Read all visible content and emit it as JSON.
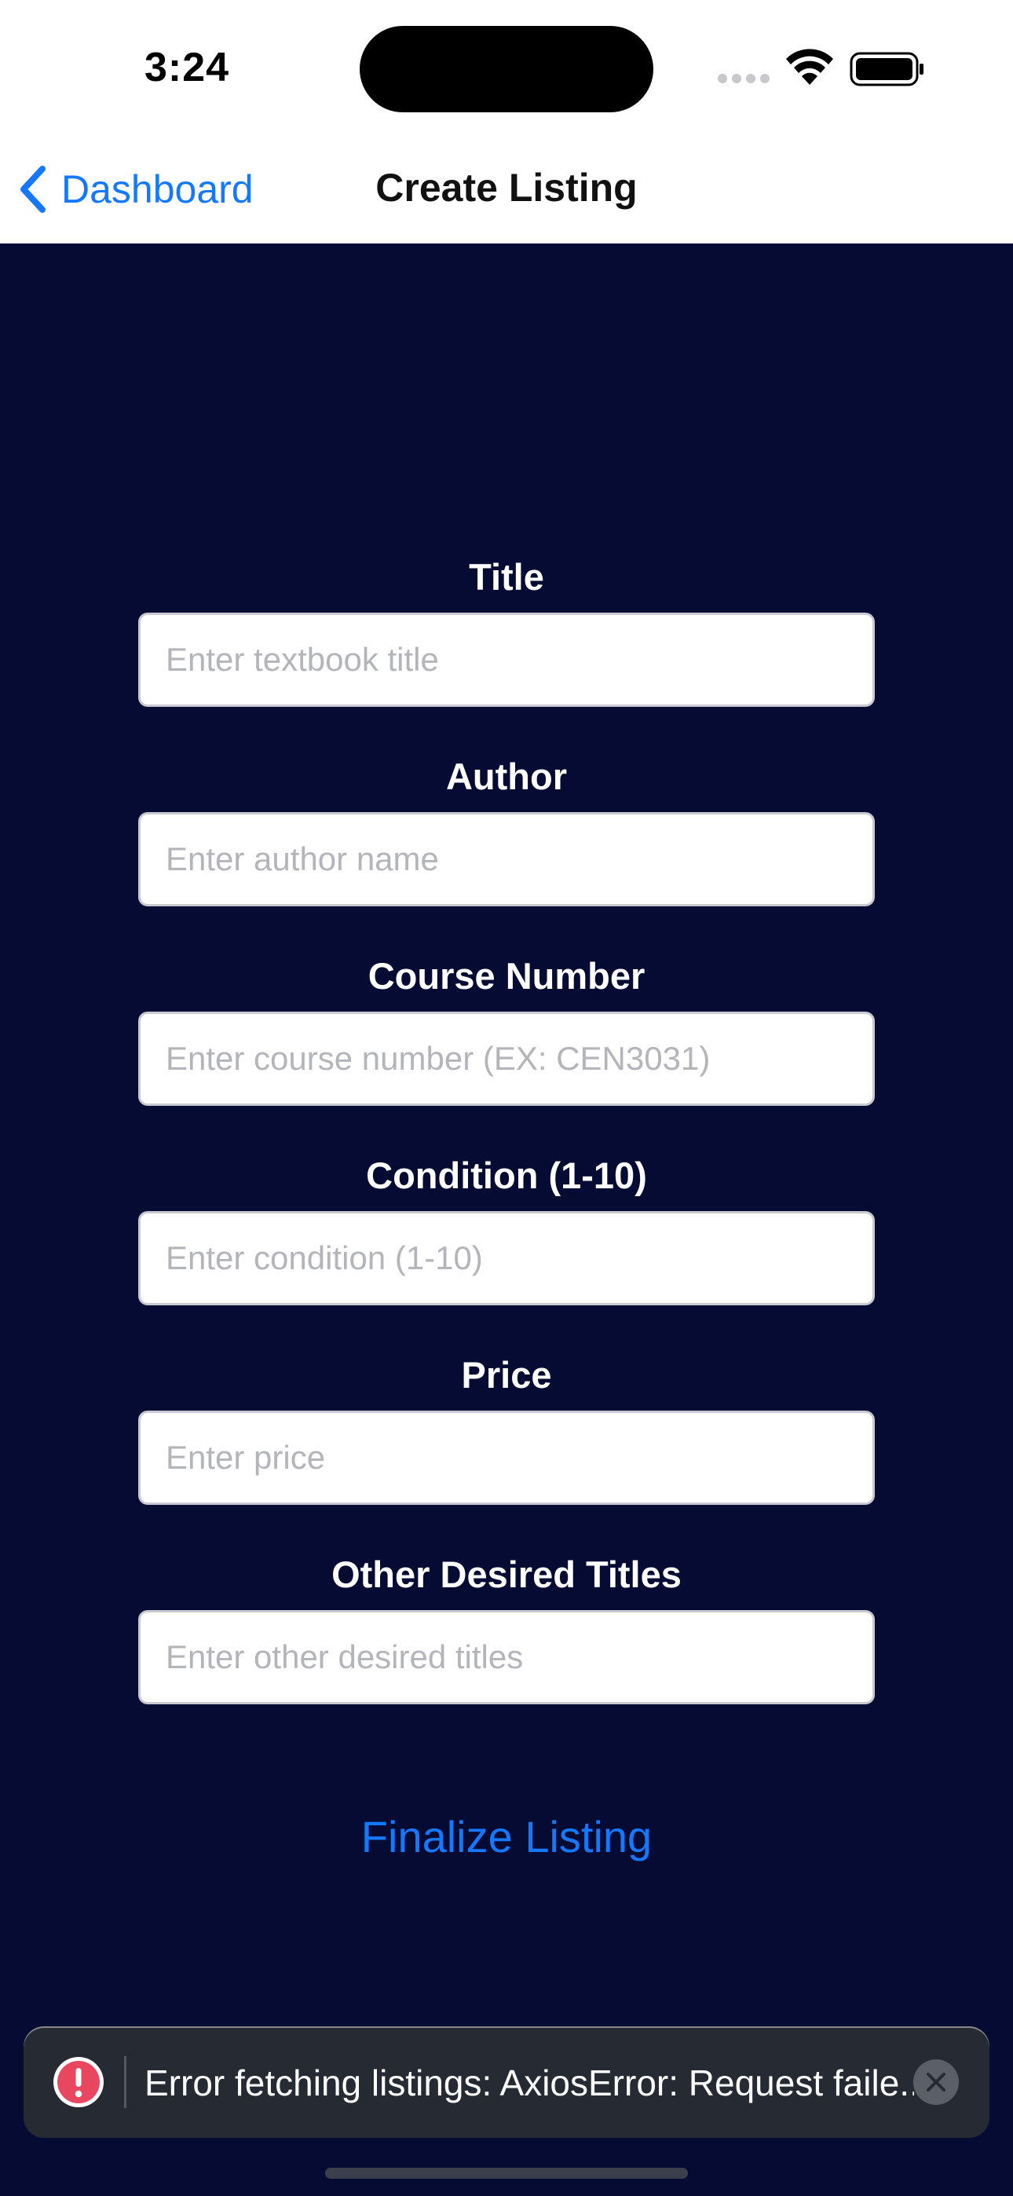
{
  "status_bar": {
    "time": "3:24",
    "icons": [
      "cellular-signal-icon",
      "wifi-icon",
      "battery-icon"
    ]
  },
  "nav": {
    "back_label": "Dashboard",
    "title": "Create Listing"
  },
  "form": {
    "fields": [
      {
        "label": "Title",
        "placeholder": "Enter textbook title",
        "value": ""
      },
      {
        "label": "Author",
        "placeholder": "Enter author name",
        "value": ""
      },
      {
        "label": "Course Number",
        "placeholder": "Enter course number (EX: CEN3031)",
        "value": ""
      },
      {
        "label": "Condition (1-10)",
        "placeholder": "Enter condition (1-10)",
        "value": ""
      },
      {
        "label": "Price",
        "placeholder": "Enter price",
        "value": ""
      },
      {
        "label": "Other Desired Titles",
        "placeholder": "Enter other desired titles",
        "value": ""
      }
    ],
    "submit_label": "Finalize Listing"
  },
  "toast": {
    "message": "Error fetching listings: AxiosError: Request faile...",
    "icon": "error-icon"
  },
  "colors": {
    "background": "#060b33",
    "accent": "#1479ff",
    "error": "#e8475f"
  }
}
